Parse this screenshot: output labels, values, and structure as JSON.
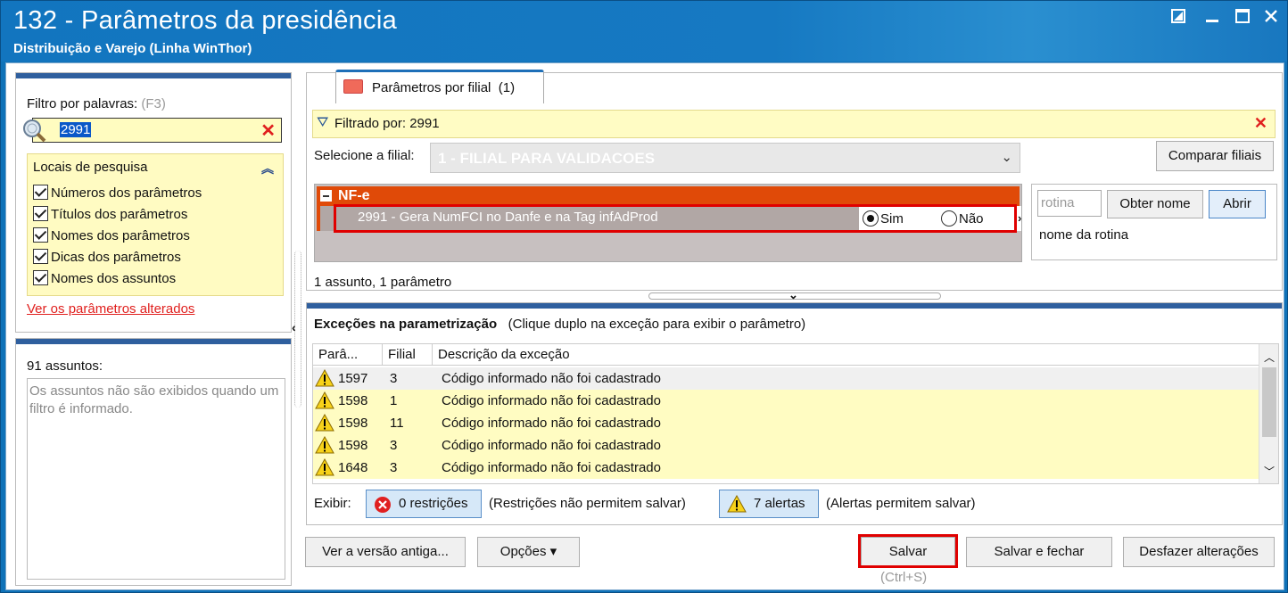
{
  "window": {
    "title": "132 - Parâmetros da presidência",
    "subtitle": "Distribuição e Varejo (Linha WinThor)",
    "controls": [
      "restore-down",
      "minimize",
      "maximize",
      "close"
    ]
  },
  "left": {
    "filter_label": "Filtro por palavras:",
    "filter_shortcut": "(F3)",
    "filter_value": "2991",
    "locais_title": "Locais de pesquisa",
    "checkboxes": [
      {
        "label": "Números dos parâmetros",
        "checked": true
      },
      {
        "label": "Títulos dos parâmetros",
        "checked": true
      },
      {
        "label": "Nomes dos parâmetros",
        "checked": true
      },
      {
        "label": "Dicas dos parâmetros",
        "checked": true
      },
      {
        "label": "Nomes dos assuntos",
        "checked": true
      }
    ],
    "changed_link": "Ver os parâmetros alterados",
    "subjects_count": "91 assuntos:",
    "subjects_note": "Os assuntos não são exibidos quando um filtro é informado."
  },
  "tab": {
    "label": "Parâmetros por filial",
    "count": "(1)"
  },
  "filter_bar": {
    "text": "Filtrado por: 2991"
  },
  "branch": {
    "label": "Selecione a filial:",
    "value": "1 - FILIAL PARA VALIDACOES",
    "compare_button": "Comparar filiais"
  },
  "params": {
    "group": "NF-e",
    "row": "2991 - Gera NumFCI no Danfe e na Tag infAdProd",
    "opt_yes": "Sim",
    "opt_no": "Não",
    "selected": "Sim",
    "summary": "1 assunto, 1 parâmetro"
  },
  "routine": {
    "placeholder": "rotina",
    "get_name_button": "Obter nome",
    "open_button": "Abrir",
    "name_label": "nome da rotina"
  },
  "exceptions": {
    "title": "Exceções na parametrização",
    "hint": "(Clique duplo na exceção para exibir o parâmetro)",
    "columns": [
      "Parâ...",
      "Filial",
      "Descrição da exceção"
    ],
    "rows": [
      {
        "param": "1597",
        "filial": "3",
        "desc": "Código informado não foi cadastrado"
      },
      {
        "param": "1598",
        "filial": "1",
        "desc": "Código informado não foi cadastrado"
      },
      {
        "param": "1598",
        "filial": "11",
        "desc": "Código informado não foi cadastrado"
      },
      {
        "param": "1598",
        "filial": "3",
        "desc": "Código informado não foi cadastrado"
      },
      {
        "param": "1648",
        "filial": "3",
        "desc": "Código informado não foi cadastrado"
      }
    ],
    "show_label": "Exibir:",
    "restrictions_button": "0 restrições",
    "restrictions_note": "(Restrições não permitem salvar)",
    "alerts_button": "7 alertas",
    "alerts_note": "(Alertas permitem salvar)"
  },
  "footer": {
    "old_version": "Ver a versão antiga...",
    "options": "Opções",
    "save": "Salvar",
    "save_shortcut": "(Ctrl+S)",
    "save_close": "Salvar e fechar",
    "undo": "Desfazer alterações"
  },
  "colors": {
    "accent": "#1275bf",
    "group": "#e04a08",
    "highlight": "#e00000",
    "filter_bg": "#fffcc2"
  }
}
